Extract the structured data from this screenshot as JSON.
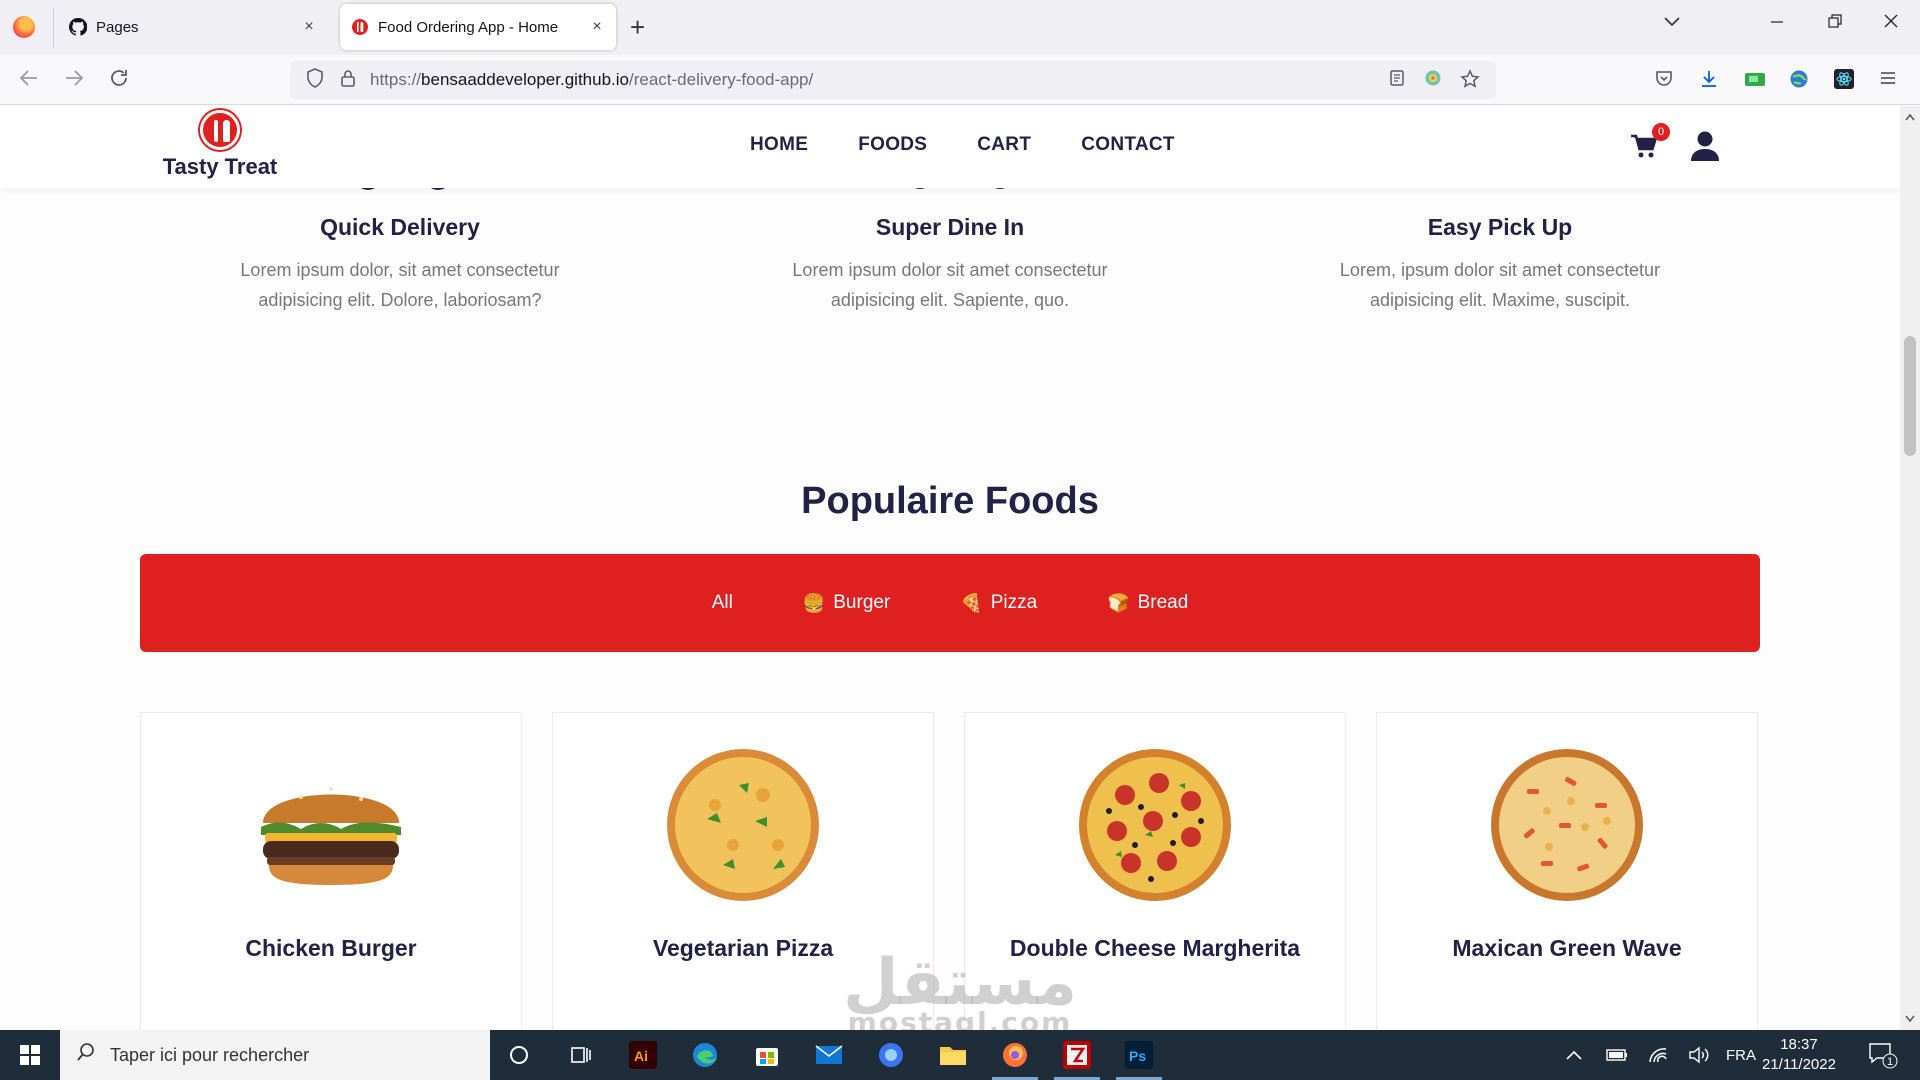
{
  "browser": {
    "tabs": [
      {
        "title": "Pages",
        "active": false
      },
      {
        "title": "Food Ordering App - Home",
        "active": true
      }
    ],
    "close_symbol": "×",
    "new_tab_symbol": "+",
    "url": {
      "prefix": "https://",
      "domain": "bensaaddeveloper.github.io",
      "path": "/react-delivery-food-app/"
    }
  },
  "site": {
    "brand": "Tasty Treat",
    "menu": [
      "HOME",
      "FOODS",
      "CART",
      "CONTACT"
    ],
    "cart_count": "0",
    "features": [
      {
        "title": "Quick Delivery",
        "line1": "Lorem ipsum dolor, sit amet consectetur",
        "line2": "adipisicing elit. Dolore, laboriosam?"
      },
      {
        "title": "Super Dine In",
        "line1": "Lorem ipsum dolor sit amet consectetur",
        "line2": "adipisicing elit. Sapiente, quo."
      },
      {
        "title": "Easy Pick Up",
        "line1": "Lorem, ipsum dolor sit amet consectetur",
        "line2": "adipisicing elit. Maxime, suscipit."
      }
    ],
    "section_title": "Populaire Foods",
    "filters": [
      {
        "label": "All",
        "icon": ""
      },
      {
        "label": "Burger",
        "icon": "🍔"
      },
      {
        "label": "Pizza",
        "icon": "🍕"
      },
      {
        "label": "Bread",
        "icon": "🍞"
      }
    ],
    "products": [
      {
        "name": "Chicken Burger",
        "image": "burger-image"
      },
      {
        "name": "Vegetarian Pizza",
        "image": "vegetarian-pizza-image"
      },
      {
        "name": "Double Cheese Margherita",
        "image": "pepperoni-pizza-image"
      },
      {
        "name": "Maxican Green Wave",
        "image": "mexican-pizza-image"
      }
    ],
    "colors": {
      "primary": "#df2020",
      "heading": "#212245",
      "text": "#777777"
    }
  },
  "watermark": {
    "main": "مستقل",
    "sub": "mostaql.com"
  },
  "taskbar": {
    "search_placeholder": "Taper ici pour rechercher",
    "language": "FRA",
    "time": "18:37",
    "date": "21/11/2022",
    "notification_count": "1"
  }
}
